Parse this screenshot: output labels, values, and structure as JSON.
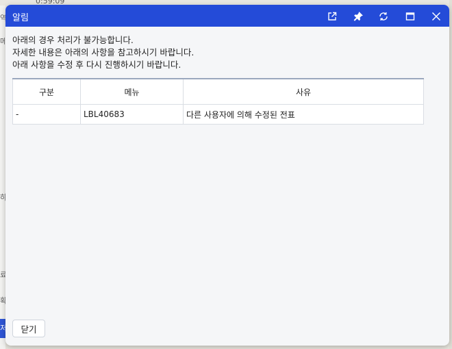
{
  "background": {
    "time_fragment": "0:59:09",
    "left_fragments": [
      "역",
      "메",
      "하",
      "료",
      "확"
    ],
    "left_tab_fragment": "저"
  },
  "dialog": {
    "title": "알림",
    "window_buttons": [
      {
        "name": "external-link-icon"
      },
      {
        "name": "pin-icon"
      },
      {
        "name": "refresh-icon"
      },
      {
        "name": "maximize-icon"
      },
      {
        "name": "close-icon"
      }
    ],
    "message_lines": [
      "아래의 경우 처리가 불가능합니다.",
      "자세한 내용은 아래의 사항을 참고하시기 바랍니다.",
      "아래 사항을 수정 후 다시 진행하시기 바랍니다."
    ],
    "table": {
      "headers": [
        "구분",
        "메뉴",
        "사유"
      ],
      "rows": [
        [
          "-",
          "LBL40683",
          "다른 사용자에 의해 수정된 전표"
        ]
      ]
    },
    "close_button_label": "닫기"
  }
}
